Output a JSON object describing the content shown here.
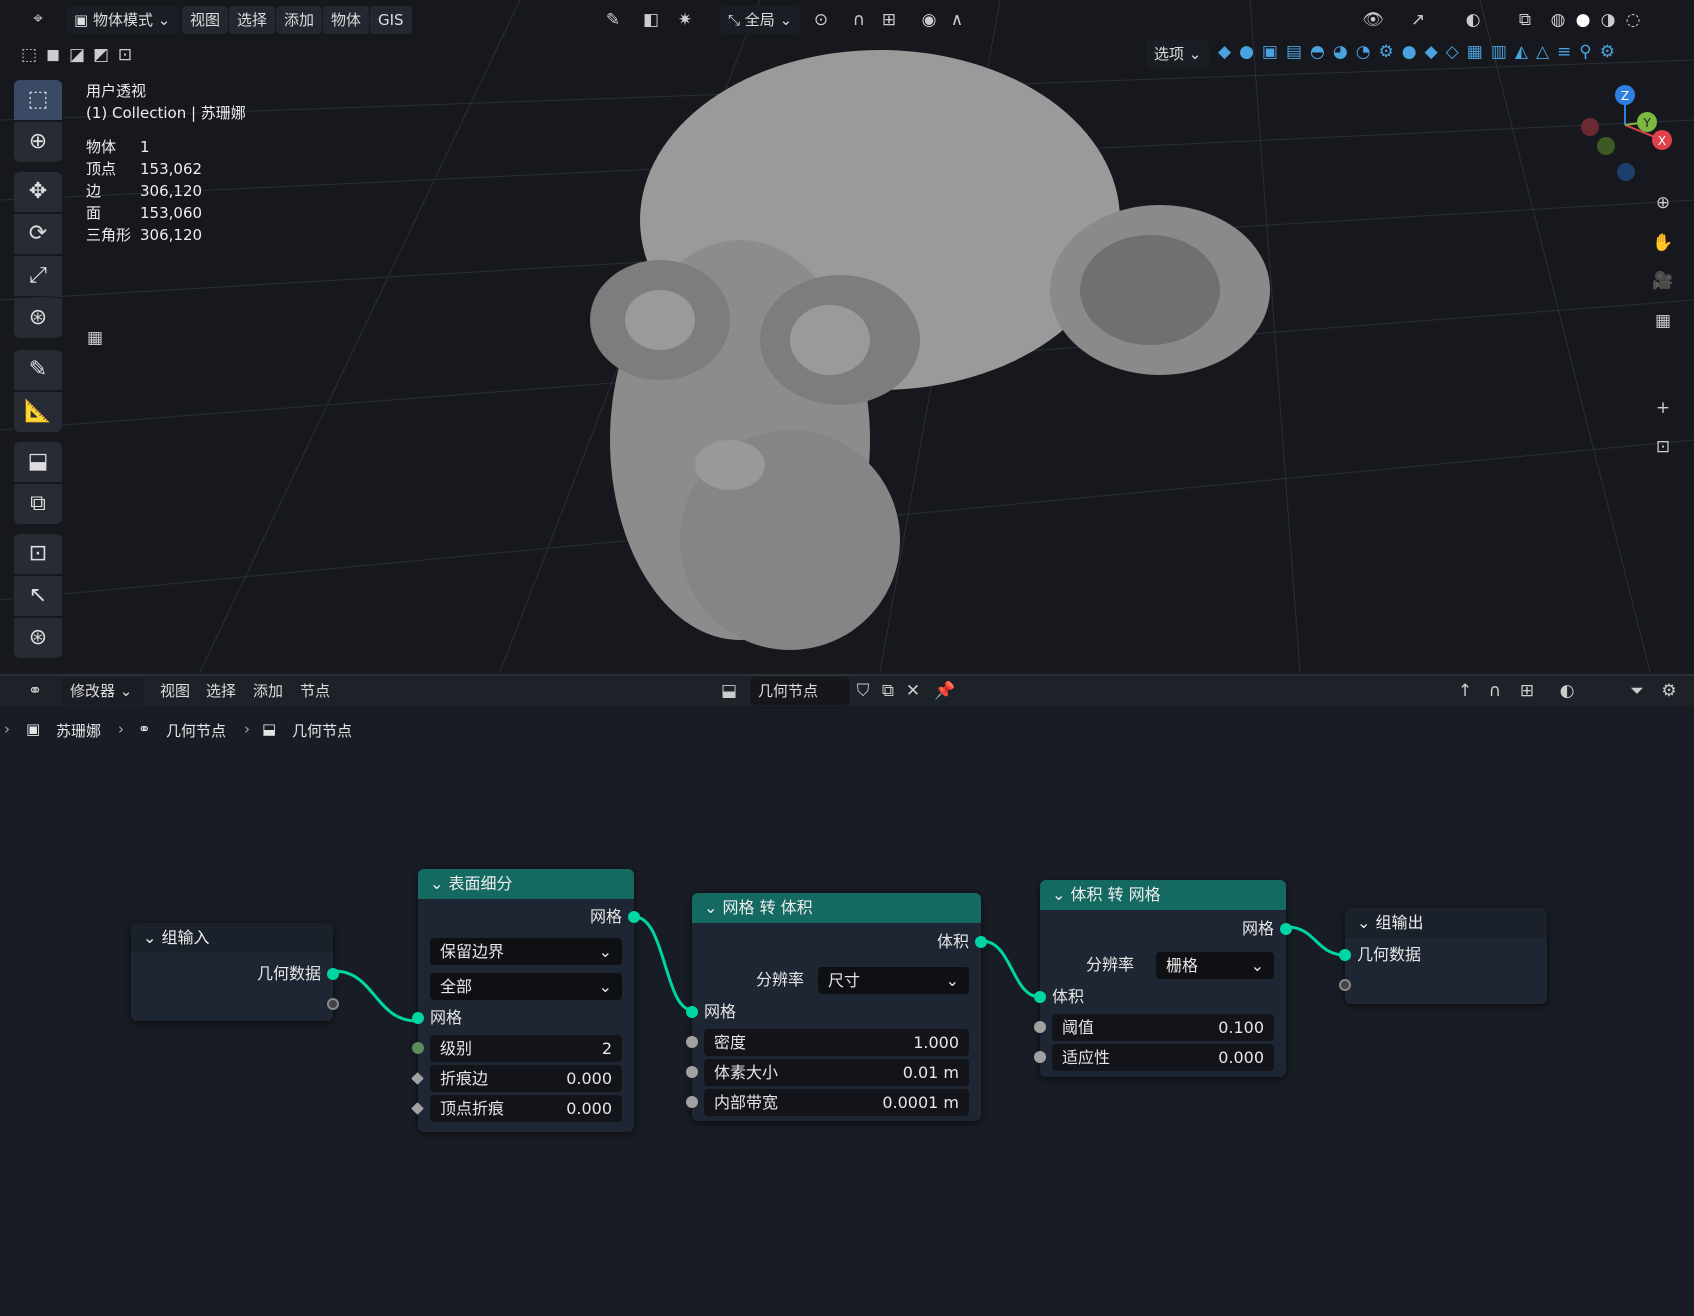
{
  "header": {
    "mode": "物体模式",
    "menus": [
      "视图",
      "选择",
      "添加",
      "物体",
      "GIS"
    ],
    "transform": "全局",
    "options": "选项"
  },
  "overlay": {
    "view": "用户透视",
    "collection": "(1) Collection | 苏珊娜",
    "stats": [
      {
        "k": "物体",
        "v": "1"
      },
      {
        "k": "顶点",
        "v": "153,062"
      },
      {
        "k": "边",
        "v": "306,120"
      },
      {
        "k": "面",
        "v": "153,060"
      },
      {
        "k": "三角形",
        "v": "306,120"
      }
    ]
  },
  "gizmo": {
    "z": "Z",
    "y": "Y",
    "x": "X"
  },
  "node_header": {
    "editor": "修改器",
    "menus": [
      "视图",
      "选择",
      "添加",
      "节点"
    ],
    "tree": "几何节点"
  },
  "breadcrumb": [
    "苏珊娜",
    "几何节点",
    "几何节点"
  ],
  "nodes": {
    "group_input": {
      "title": "组输入",
      "out": "几何数据"
    },
    "subdiv": {
      "title": "表面细分",
      "out": "网格",
      "opt1": "保留边界",
      "opt2": "全部",
      "in": "网格",
      "level_l": "级别",
      "level_v": "2",
      "crease_l": "折痕边",
      "crease_v": "0.000",
      "vcrease_l": "顶点折痕",
      "vcrease_v": "0.000"
    },
    "m2v": {
      "title": "网格 转 体积",
      "out": "体积",
      "res_l": "分辨率",
      "res_v": "尺寸",
      "in": "网格",
      "density_l": "密度",
      "density_v": "1.000",
      "voxel_l": "体素大小",
      "voxel_v": "0.01 m",
      "band_l": "内部带宽",
      "band_v": "0.0001 m"
    },
    "v2m": {
      "title": "体积 转 网格",
      "out": "网格",
      "res_l": "分辨率",
      "res_v": "栅格",
      "in": "体积",
      "thr_l": "阈值",
      "thr_v": "0.100",
      "adapt_l": "适应性",
      "adapt_v": "0.000"
    },
    "group_output": {
      "title": "组输出",
      "in": "几何数据"
    }
  }
}
